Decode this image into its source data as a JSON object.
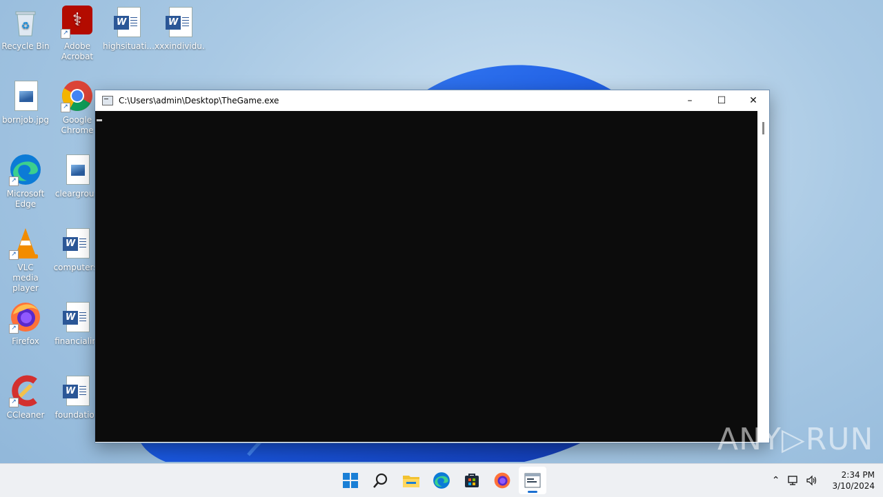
{
  "desktop": {
    "icons": [
      {
        "label": "Recycle Bin",
        "icon": "recycle-bin-icon"
      },
      {
        "label": "Adobe Acrobat",
        "icon": "adobe-acrobat-icon"
      },
      {
        "label": "highsituati...",
        "icon": "word-document-icon"
      },
      {
        "label": "xxxindividu...",
        "icon": "word-document-icon"
      },
      {
        "label": "bornjob.jpg",
        "icon": "image-file-icon"
      },
      {
        "label": "Google Chrome",
        "icon": "chrome-icon"
      },
      {
        "label": "Microsoft Edge",
        "icon": "edge-icon"
      },
      {
        "label": "cleargroup",
        "icon": "image-file-icon"
      },
      {
        "label": "VLC media player",
        "icon": "vlc-icon"
      },
      {
        "label": "computerst",
        "icon": "word-document-icon"
      },
      {
        "label": "Firefox",
        "icon": "firefox-icon"
      },
      {
        "label": "financialin.",
        "icon": "word-document-icon"
      },
      {
        "label": "CCleaner",
        "icon": "ccleaner-icon"
      },
      {
        "label": "foundation",
        "icon": "word-document-icon"
      }
    ]
  },
  "window": {
    "title": "C:\\Users\\admin\\Desktop\\TheGame.exe",
    "minimize": "–",
    "maximize": "☐",
    "close": "✕"
  },
  "watermark": "ANY▷RUN",
  "taskbar": {
    "apps": [
      "start-icon",
      "search-icon",
      "file-explorer-icon",
      "edge-icon",
      "store-icon",
      "firefox-icon",
      "console-app-icon"
    ],
    "time": "2:34 PM",
    "date": "3/10/2024"
  }
}
